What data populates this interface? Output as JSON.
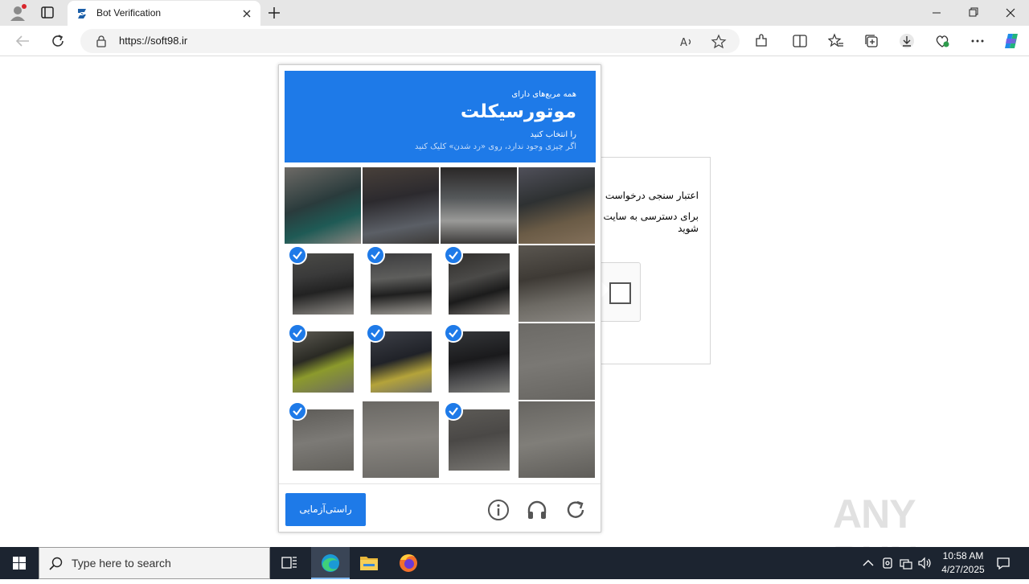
{
  "browser": {
    "tab_title": "Bot Verification",
    "url": "https://soft98.ir"
  },
  "page": {
    "verify_line1": "اعتبار سنجی درخواست",
    "verify_line2": "برای دسترسی به سایت وارد شوید"
  },
  "captcha": {
    "header_line1": "همه مربع‌های دارای",
    "header_object": "موتورسیکلت",
    "header_line3": "را انتخاب کنید",
    "header_line4": "اگر چیزی وجود ندارد، روی «رد شدن» کلیک کنید",
    "verify_button": "راستی‌آزمایی",
    "tiles": [
      {
        "selected": false
      },
      {
        "selected": false
      },
      {
        "selected": false
      },
      {
        "selected": false
      },
      {
        "selected": true
      },
      {
        "selected": true
      },
      {
        "selected": true
      },
      {
        "selected": false
      },
      {
        "selected": true
      },
      {
        "selected": true
      },
      {
        "selected": true
      },
      {
        "selected": false
      },
      {
        "selected": true
      },
      {
        "selected": false
      },
      {
        "selected": true
      },
      {
        "selected": false
      }
    ],
    "accent_color": "#1e7ae8"
  },
  "watermark": "ANY RUN",
  "taskbar": {
    "search_placeholder": "Type here to search",
    "time": "10:58 AM",
    "date": "4/27/2025"
  }
}
